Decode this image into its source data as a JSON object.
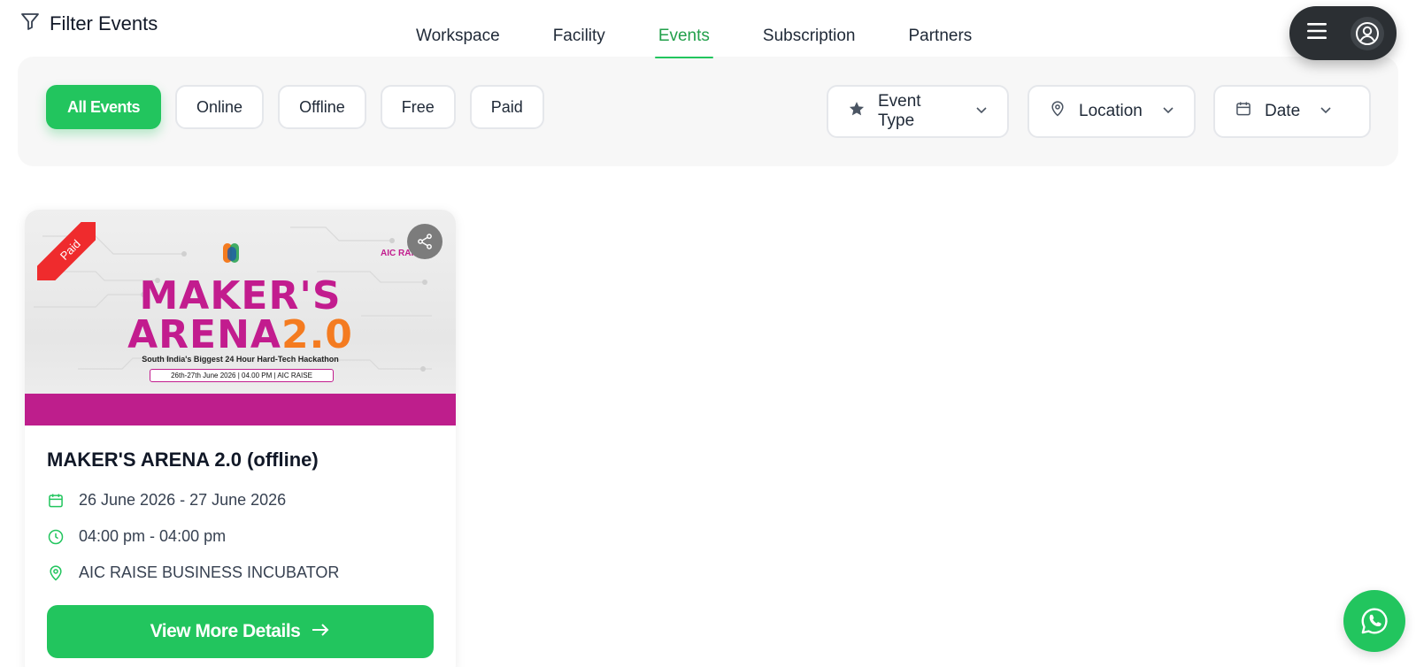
{
  "header": {
    "filter_title": "Filter Events",
    "nav": [
      {
        "label": "Workspace",
        "active": false
      },
      {
        "label": "Facility",
        "active": false
      },
      {
        "label": "Events",
        "active": true
      },
      {
        "label": "Subscription",
        "active": false
      },
      {
        "label": "Partners",
        "active": false
      }
    ]
  },
  "filters": {
    "chips": [
      {
        "label": "All Events",
        "active": true
      },
      {
        "label": "Online",
        "active": false
      },
      {
        "label": "Offline",
        "active": false
      },
      {
        "label": "Free",
        "active": false
      },
      {
        "label": "Paid",
        "active": false
      }
    ],
    "dropdowns": [
      {
        "label": "Event Type",
        "icon": "star-icon"
      },
      {
        "label": "Location",
        "icon": "map-pin-icon"
      },
      {
        "label": "Date",
        "icon": "calendar-icon"
      }
    ]
  },
  "event_card": {
    "badge": "Paid",
    "poster": {
      "line1": "MAKER'S",
      "line2_main": "ARENA",
      "line2_accent": "2.0",
      "subtitle": "South India's Biggest 24 Hour Hard-Tech Hackathon",
      "info": "26th-27th June 2026 | 04.00 PM | AIC RAISE",
      "logo_text": "AIC RAISE"
    },
    "title": "MAKER'S ARENA 2.0 (offline)",
    "date": "26 June 2026 - 27 June 2026",
    "time": "04:00 pm - 04:00 pm",
    "location": "AIC RAISE BUSINESS INCUBATOR",
    "cta": "View More Details"
  },
  "colors": {
    "accent": "#22c55e",
    "dark_pill": "#2b2f33",
    "poster_magenta": "#c21c8e",
    "poster_orange": "#f47b20",
    "badge_red": "#ef2b2d"
  }
}
